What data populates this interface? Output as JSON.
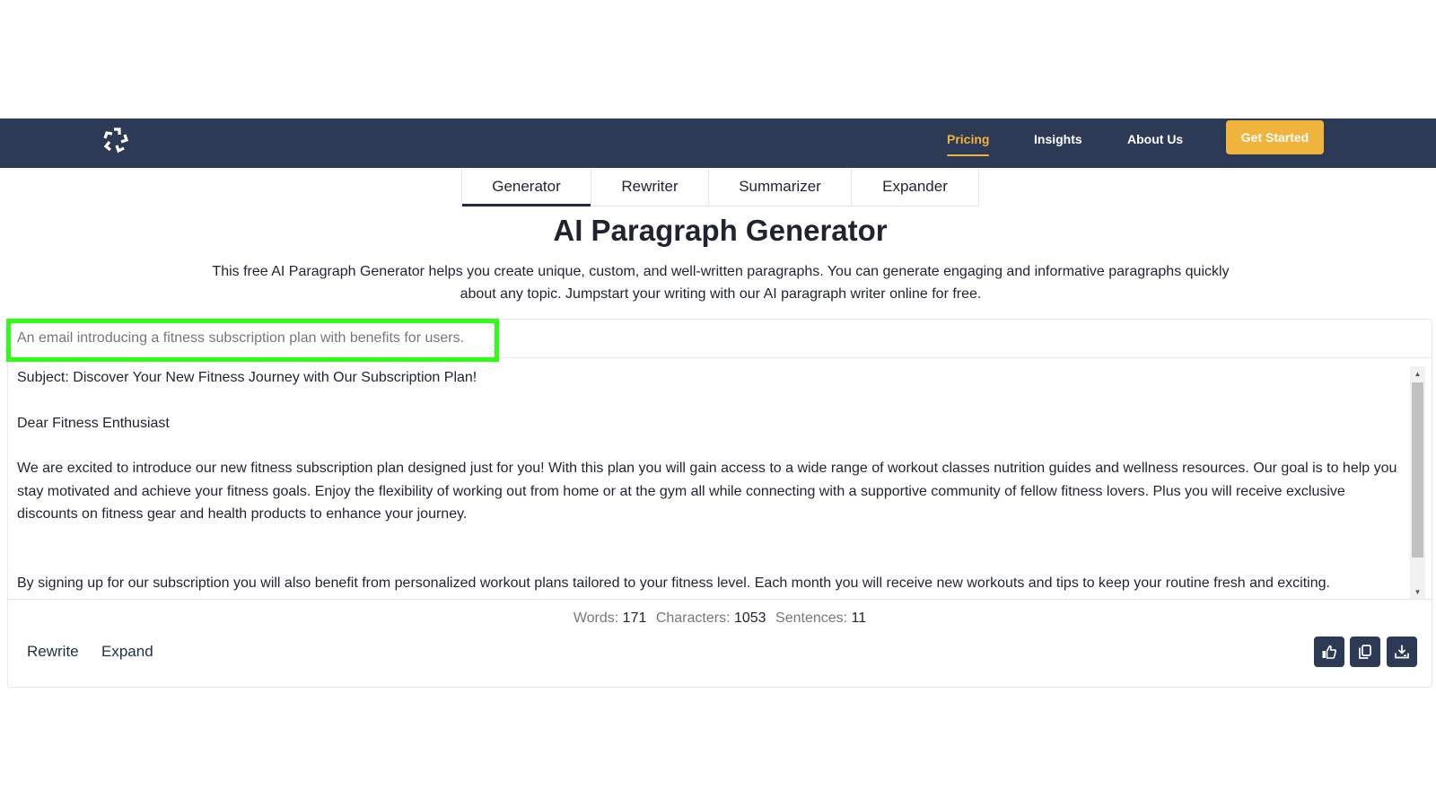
{
  "navbar": {
    "logo_icon": "pinwheel-logo-icon",
    "links": [
      {
        "label": "Pricing",
        "active": true
      },
      {
        "label": "Insights",
        "active": false
      },
      {
        "label": "About Us",
        "active": false
      }
    ],
    "cta_label": "Get Started",
    "colors": {
      "background": "#2d3a55",
      "accent": "#f0b43d"
    }
  },
  "tabs": [
    {
      "label": "Generator",
      "active": true
    },
    {
      "label": "Rewriter",
      "active": false
    },
    {
      "label": "Summarizer",
      "active": false
    },
    {
      "label": "Expander",
      "active": false
    }
  ],
  "page": {
    "title": "AI Paragraph Generator",
    "description": "This free AI Paragraph Generator helps you create unique, custom, and well-written paragraphs. You can generate engaging and informative paragraphs quickly about any topic. Jumpstart your writing with our AI paragraph writer online for free."
  },
  "editor": {
    "prompt_value": "An email introducing a fitness subscription plan with benefits for users.",
    "highlight_color": "#2bff14",
    "output_paragraphs": [
      "Subject: Discover Your New Fitness Journey with Our Subscription Plan!",
      "Dear Fitness Enthusiast",
      "We are excited to introduce our new fitness subscription plan designed just for you! With this plan you will gain access to a wide range of workout classes nutrition guides and wellness resources. Our goal is to help you stay motivated and achieve your fitness goals. Enjoy the flexibility of working out from home or at the gym all while connecting with a supportive community of fellow fitness lovers. Plus you will receive exclusive discounts on fitness gear and health products to enhance your journey.",
      "By signing up for our subscription you will also benefit from personalized workout plans tailored to your fitness level. Each month you will receive new workouts and tips to keep your routine fresh and exciting. Additionally our expert trainers will be available for live Q&A sessions to answer your questions and provide guidance. Join us today to take the first step toward a healthier happier you. We can't wait to see"
    ],
    "stats": {
      "words_label": "Words:",
      "words": "171",
      "characters_label": "Characters:",
      "characters": "1053",
      "sentences_label": "Sentences:",
      "sentences": "11"
    },
    "actions": {
      "rewrite": "Rewrite",
      "expand": "Expand"
    },
    "icon_buttons": [
      "thumbs-up-icon",
      "copy-icon",
      "download-icon"
    ]
  }
}
